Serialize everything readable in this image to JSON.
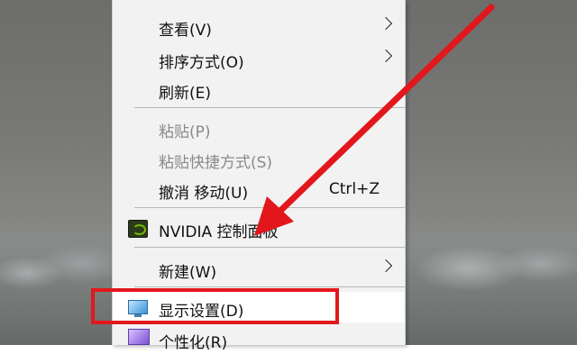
{
  "menu": {
    "items": [
      {
        "label": "查看(V)",
        "submenu": true
      },
      {
        "label": "排序方式(O)",
        "submenu": true
      },
      {
        "label": "刷新(E)"
      },
      {
        "label": "粘贴(P)",
        "disabled": true
      },
      {
        "label": "粘贴快捷方式(S)",
        "disabled": true
      },
      {
        "label": "撤消 移动(U)",
        "shortcut": "Ctrl+Z"
      },
      {
        "label": "NVIDIA 控制面板",
        "icon": "nvidia-icon"
      },
      {
        "label": "新建(W)",
        "submenu": true
      },
      {
        "label": "显示设置(D)",
        "icon": "display-icon",
        "highlighted": true
      },
      {
        "label": "个性化(R)",
        "icon": "personalize-icon"
      }
    ]
  },
  "annotation": {
    "arrow_color": "#e2171c",
    "box_color": "#e2171c"
  }
}
